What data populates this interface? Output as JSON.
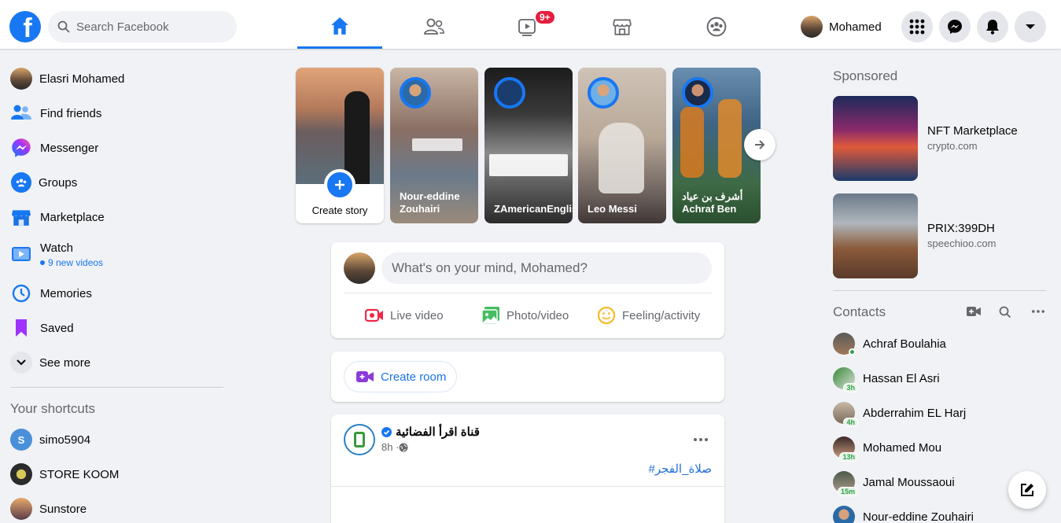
{
  "search": {
    "placeholder": "Search Facebook"
  },
  "nav": {
    "tabs": [
      {
        "name": "home",
        "active": true
      },
      {
        "name": "friends"
      },
      {
        "name": "watch",
        "badge": "9+"
      },
      {
        "name": "marketplace"
      },
      {
        "name": "groups"
      }
    ],
    "profile_name": "Mohamed"
  },
  "sidebar": {
    "items": [
      {
        "label": "Elasri Mohamed",
        "icon": "profile-avatar"
      },
      {
        "label": "Find friends",
        "icon": "friends-icon"
      },
      {
        "label": "Messenger",
        "icon": "messenger-icon"
      },
      {
        "label": "Groups",
        "icon": "groups-icon"
      },
      {
        "label": "Marketplace",
        "icon": "marketplace-icon"
      },
      {
        "label": "Watch",
        "icon": "watch-icon",
        "sub": "9 new videos"
      },
      {
        "label": "Memories",
        "icon": "memories-icon"
      },
      {
        "label": "Saved",
        "icon": "saved-icon"
      },
      {
        "label": "See more",
        "icon": "chevron-down-icon"
      }
    ],
    "shortcuts_title": "Your shortcuts",
    "shortcuts": [
      {
        "label": "simo5904",
        "initial": "S"
      },
      {
        "label": "STORE KOOM"
      },
      {
        "label": "Sunstore"
      }
    ]
  },
  "stories": {
    "create_label": "Create story",
    "items": [
      {
        "name": "Nour-eddine Zouhairi"
      },
      {
        "name": "ZAmericanEnglish"
      },
      {
        "name": "Leo Messi"
      },
      {
        "name": "أشرف بن عياد Achraf Ben"
      }
    ]
  },
  "composer": {
    "placeholder": "What's on your mind, Mohamed?",
    "actions": [
      "Live video",
      "Photo/video",
      "Feeling/activity"
    ]
  },
  "room": {
    "label": "Create room"
  },
  "post": {
    "page_name": "قناة اقرأ الفضائية",
    "time": "8h · ",
    "hashtag": "#صلاة_الفجر"
  },
  "sponsored": {
    "title": "Sponsored",
    "ads": [
      {
        "title": "NFT Marketplace",
        "host": "crypto.com"
      },
      {
        "title": "PRIX:399DH",
        "host": "speechioo.com"
      }
    ]
  },
  "contacts": {
    "title": "Contacts",
    "items": [
      {
        "name": "Achraf Boulahia",
        "status": "online"
      },
      {
        "name": "Hassan El Asri",
        "time": "3h"
      },
      {
        "name": "Abderrahim EL Harj",
        "time": "4h"
      },
      {
        "name": "Mohamed Mou",
        "time": "13h"
      },
      {
        "name": "Jamal Moussaoui",
        "time": "15m"
      },
      {
        "name": "Nour-eddine Zouhairi"
      }
    ]
  },
  "colors": {
    "brand": "#1877f2",
    "background": "#f0f2f5",
    "badge": "#e41e3f",
    "online": "#31a24c"
  }
}
